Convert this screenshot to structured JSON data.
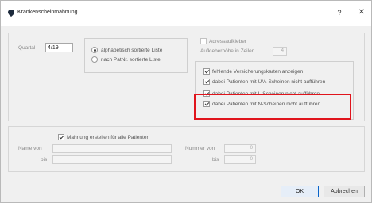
{
  "window": {
    "title": "Krankenscheinmahnung",
    "help_label": "?",
    "close_label": "✕"
  },
  "quartal": {
    "label": "Quartal",
    "value": "4/19"
  },
  "sort_options": [
    {
      "label": "alphabetisch sortierte Liste",
      "selected": true
    },
    {
      "label": "nach PatNr. sortierte Liste",
      "selected": false
    }
  ],
  "adress": {
    "label": "Adressaufkleber",
    "checked": false,
    "height_label": "Aufkleberhöhe in Zeilen",
    "height_value": "4"
  },
  "options": [
    {
      "label": "fehlende Versicherungskarten anzeigen",
      "checked": true
    },
    {
      "label": "dabei Patienten mit Ü/A-Scheinen nicht aufführen",
      "checked": true
    },
    {
      "label": "dabei Patienten mit L-Scheinen nicht aufführen",
      "checked": true
    },
    {
      "label": "dabei Patienten mit N-Scheinen nicht aufführen",
      "checked": true
    }
  ],
  "mahnung": {
    "label": "Mahnung erstellen für alle Patienten",
    "checked": true
  },
  "filter": {
    "name_von_label": "Name von",
    "name_bis_label": "bis",
    "nummer_von_label": "Nummer von",
    "nummer_bis_label": "bis",
    "nummer_von_value": "0",
    "nummer_bis_value": "0"
  },
  "buttons": {
    "ok": "OK",
    "cancel": "Abbrechen"
  },
  "colors": {
    "highlight": "#e0141c",
    "ok_border": "#0a64c8"
  }
}
